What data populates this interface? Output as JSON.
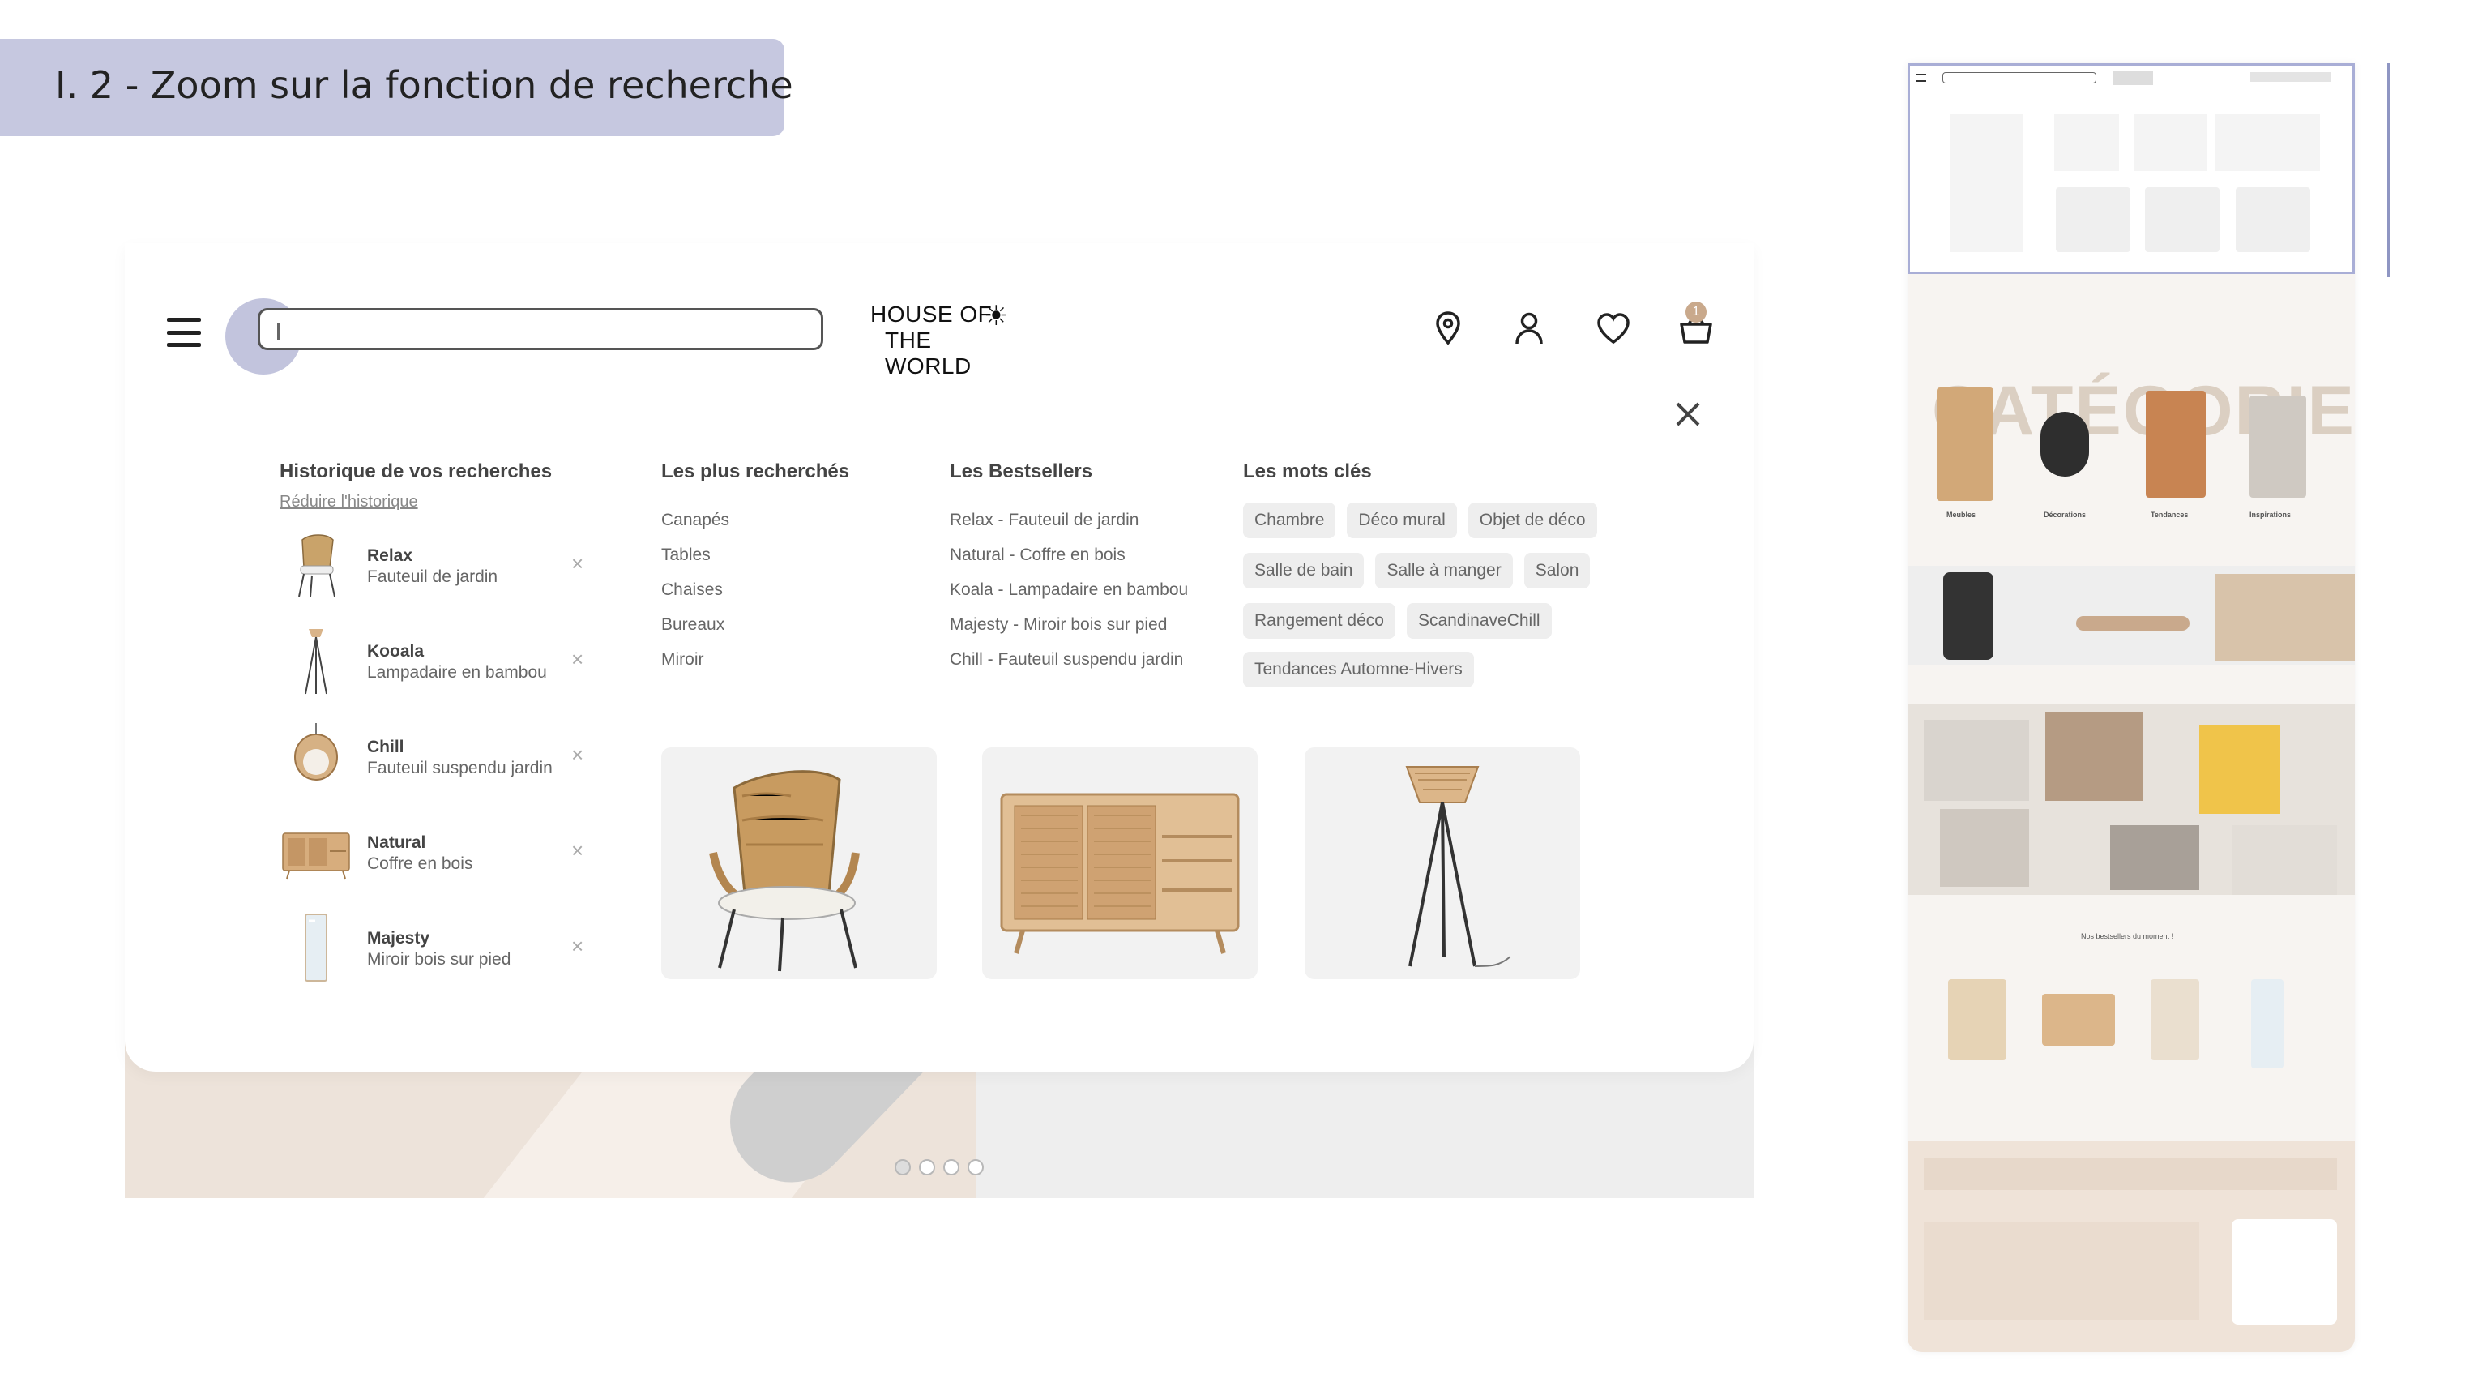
{
  "slide": {
    "title": "I. 2 - Zoom sur la fonction de recherche"
  },
  "header": {
    "search": {
      "value": "",
      "placeholder": ""
    },
    "logo": {
      "line1": "HOUSE OF",
      "line2": "THE WORLD"
    },
    "icons": [
      "map-pin-icon",
      "user-icon",
      "heart-icon",
      "basket-icon"
    ],
    "cart_count": "1"
  },
  "history": {
    "heading": "Historique de vos recherches",
    "reduce_link": "Réduire l'historique",
    "items": [
      {
        "name": "Relax",
        "sub": "Fauteuil de jardin"
      },
      {
        "name": "Kooala",
        "sub": "Lampadaire en bambou"
      },
      {
        "name": "Chill",
        "sub": "Fauteuil suspendu jardin"
      },
      {
        "name": "Natural",
        "sub": "Coffre en bois"
      },
      {
        "name": "Majesty",
        "sub": "Miroir bois sur pied"
      }
    ]
  },
  "most_searched": {
    "heading": "Les plus recherchés",
    "items": [
      "Canapés",
      "Tables",
      "Chaises",
      "Bureaux",
      "Miroir"
    ]
  },
  "bestsellers": {
    "heading": "Les Bestsellers",
    "items": [
      "Relax - Fauteuil de jardin",
      "Natural - Coffre en bois",
      "Koala - Lampadaire en bambou",
      "Majesty - Miroir bois sur pied",
      "Chill - Fauteuil suspendu jardin"
    ]
  },
  "keywords": {
    "heading": "Les mots clés",
    "rows": [
      [
        "Chambre",
        "Déco mural",
        "Objet de déco"
      ],
      [
        "Salle de bain",
        "Salle à manger",
        "Salon"
      ],
      [
        "Rangement déco",
        "ScandinaveChill"
      ],
      [
        "Tendances Automne-Hivers"
      ]
    ]
  },
  "colors": {
    "accent": "#c6c8e0",
    "panel_bg": "#ffffff",
    "tag_bg": "#eeeeee",
    "hero_bg": "#ede3da"
  },
  "side_preview": {
    "categories_title": "CATÉGORIES",
    "categories": [
      "Meubles",
      "Décorations",
      "Tendances",
      "Inspirations"
    ],
    "bestsellers_caption": "Nos bestsellers du moment !"
  }
}
